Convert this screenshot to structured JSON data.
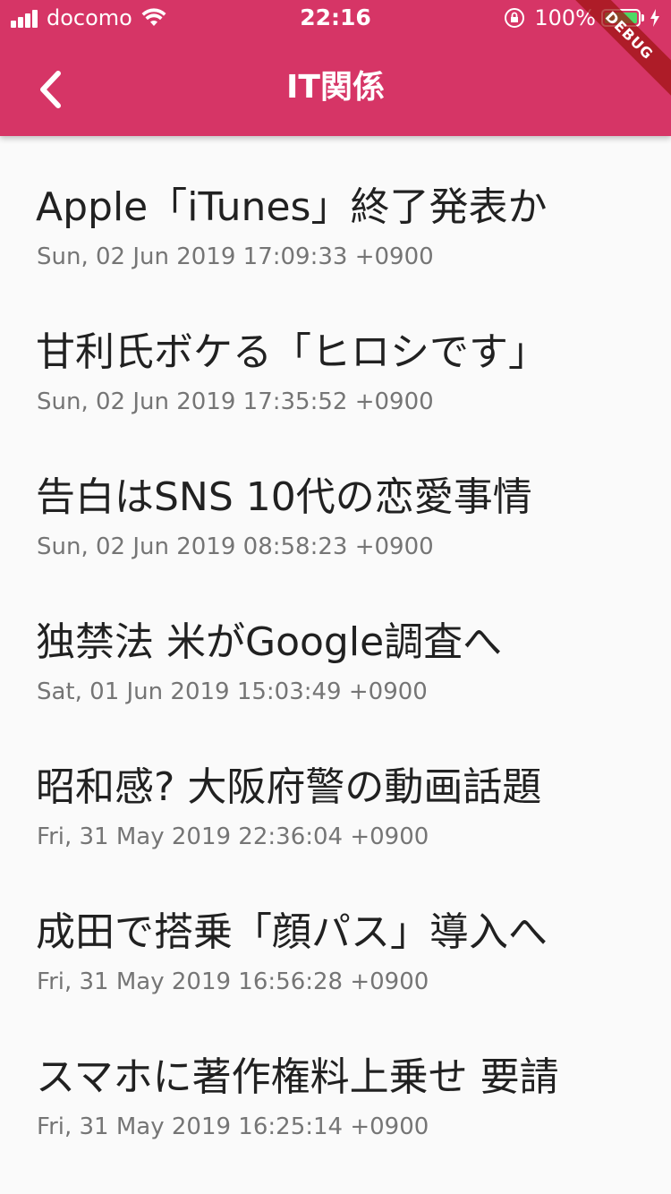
{
  "status_bar": {
    "carrier": "docomo",
    "time": "22:16",
    "battery_percent": "100%",
    "battery_color": "#4cd964"
  },
  "app_bar": {
    "title": "IT関係",
    "back_icon": "chevron-left-icon",
    "color": "#d63566"
  },
  "debug_banner": {
    "label": "DEBUG"
  },
  "articles": [
    {
      "title": "Apple「iTunes」終了発表か",
      "date": "Sun, 02 Jun 2019 17:09:33 +0900"
    },
    {
      "title": "甘利氏ボケる「ヒロシです」",
      "date": "Sun, 02 Jun 2019 17:35:52 +0900"
    },
    {
      "title": "告白はSNS 10代の恋愛事情",
      "date": "Sun, 02 Jun 2019 08:58:23 +0900"
    },
    {
      "title": "独禁法 米がGoogle調査へ",
      "date": "Sat, 01 Jun 2019 15:03:49 +0900"
    },
    {
      "title": "昭和感? 大阪府警の動画話題",
      "date": "Fri, 31 May 2019 22:36:04 +0900"
    },
    {
      "title": "成田で搭乗「顔パス」導入へ",
      "date": "Fri, 31 May 2019 16:56:28 +0900"
    },
    {
      "title": "スマホに著作権料上乗せ 要請",
      "date": "Fri, 31 May 2019 16:25:14 +0900"
    }
  ]
}
